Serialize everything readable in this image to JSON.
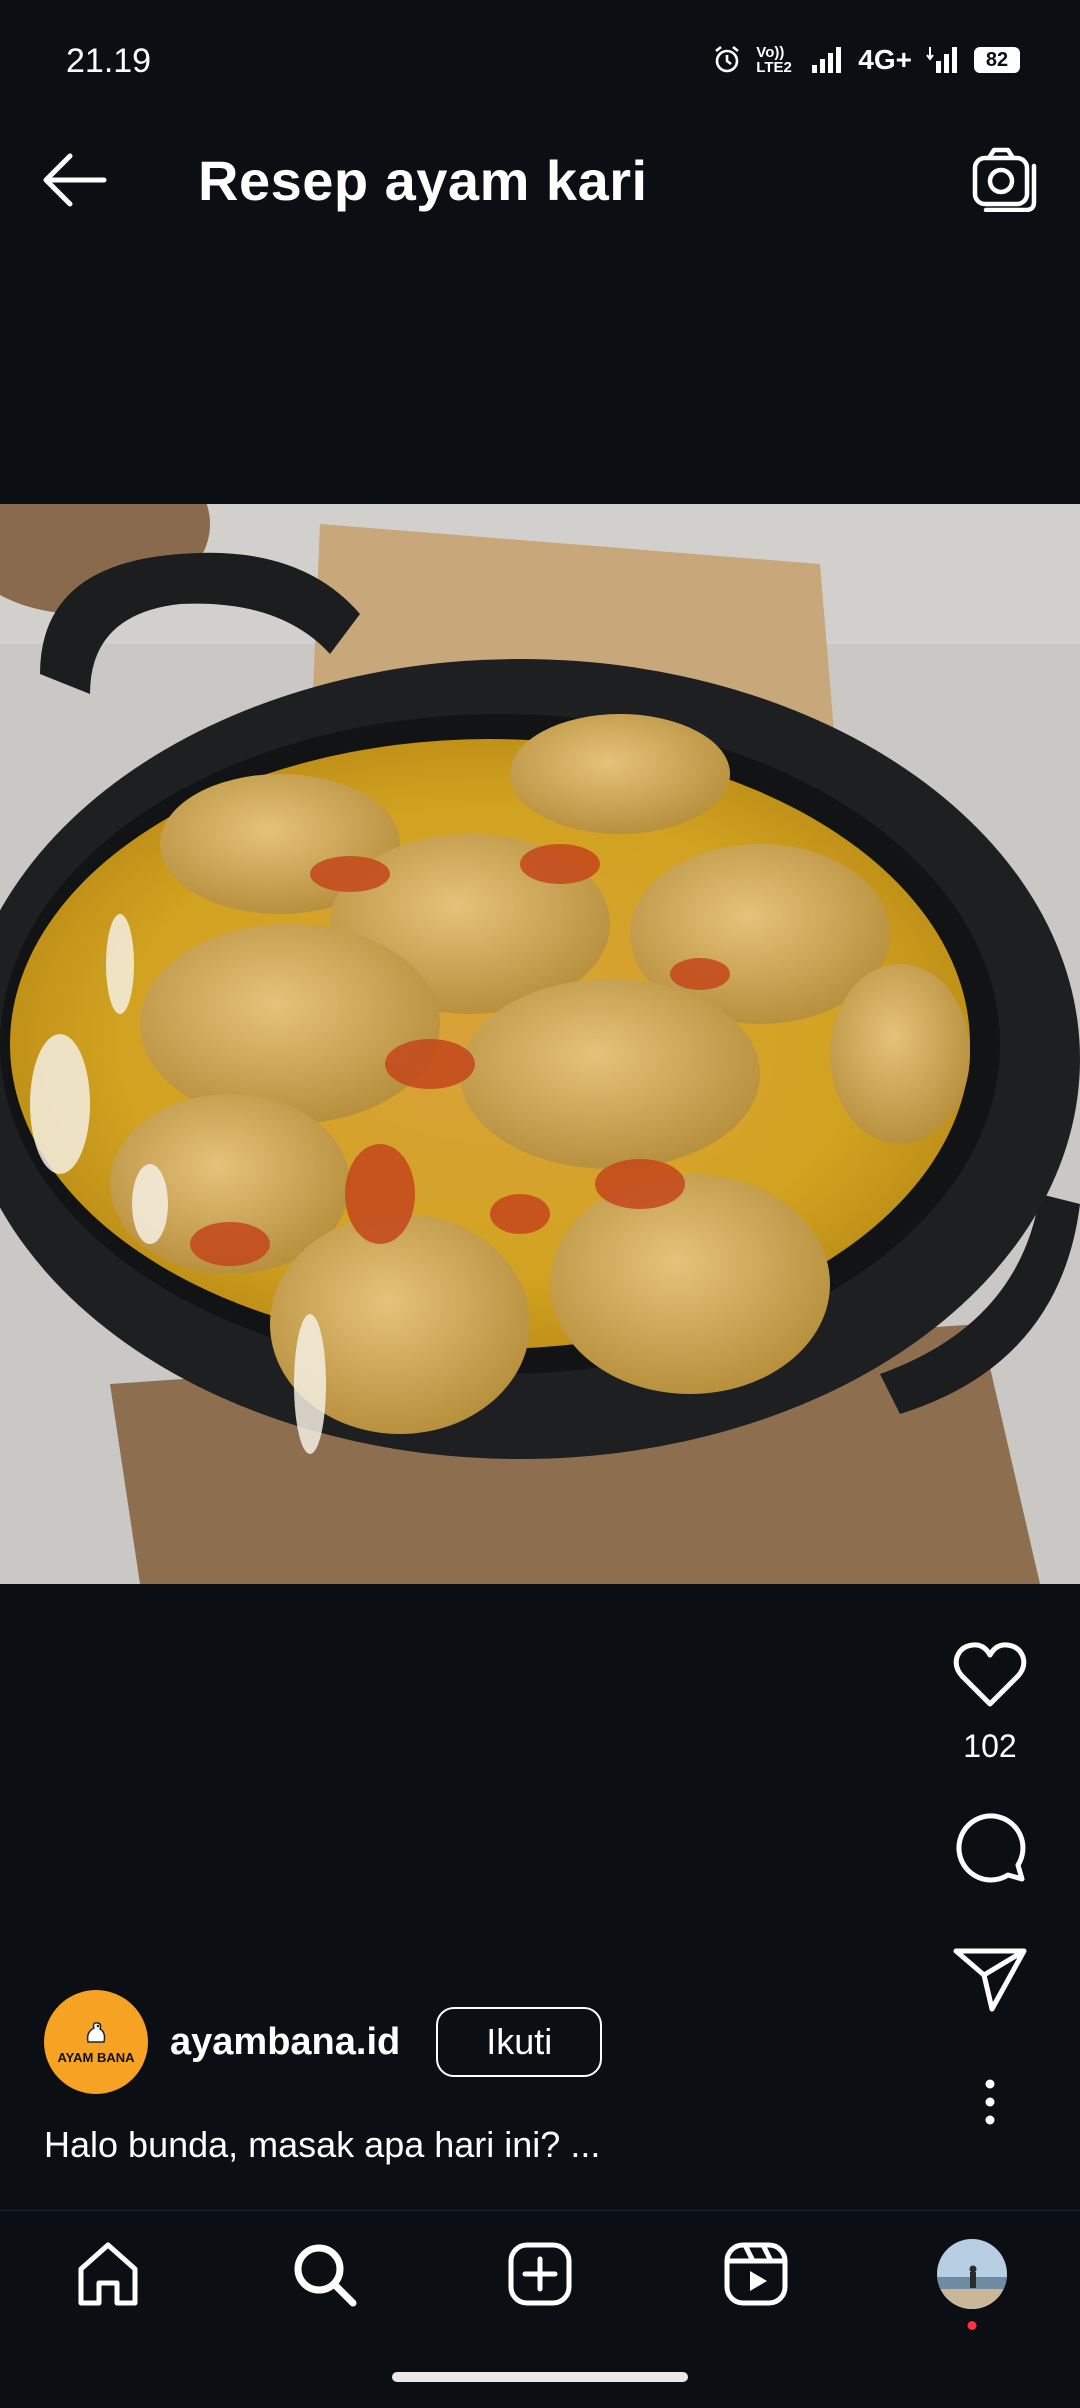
{
  "status_bar": {
    "time": "21.19",
    "volte": "Vo)) LTE2",
    "network": "4G+",
    "battery": "82"
  },
  "header": {
    "title": "Resep ayam kari"
  },
  "post": {
    "likes": "102",
    "username": "ayambana.id",
    "follow_label": "Ikuti",
    "avatar_text": "AYAM BANA",
    "caption": "Halo bunda, masak apa hari ini? ..."
  },
  "icons": {
    "back": "arrow-left-icon",
    "camera": "camera-icon",
    "like": "heart-icon",
    "comment": "comment-icon",
    "share": "send-icon",
    "more": "more-vertical-icon"
  },
  "bottom_nav": [
    "home-icon",
    "search-icon",
    "create-icon",
    "reels-icon",
    "profile-avatar"
  ],
  "colors": {
    "background": "#0b0f14",
    "avatar": "#f6a323",
    "notification": "#ff3040"
  }
}
